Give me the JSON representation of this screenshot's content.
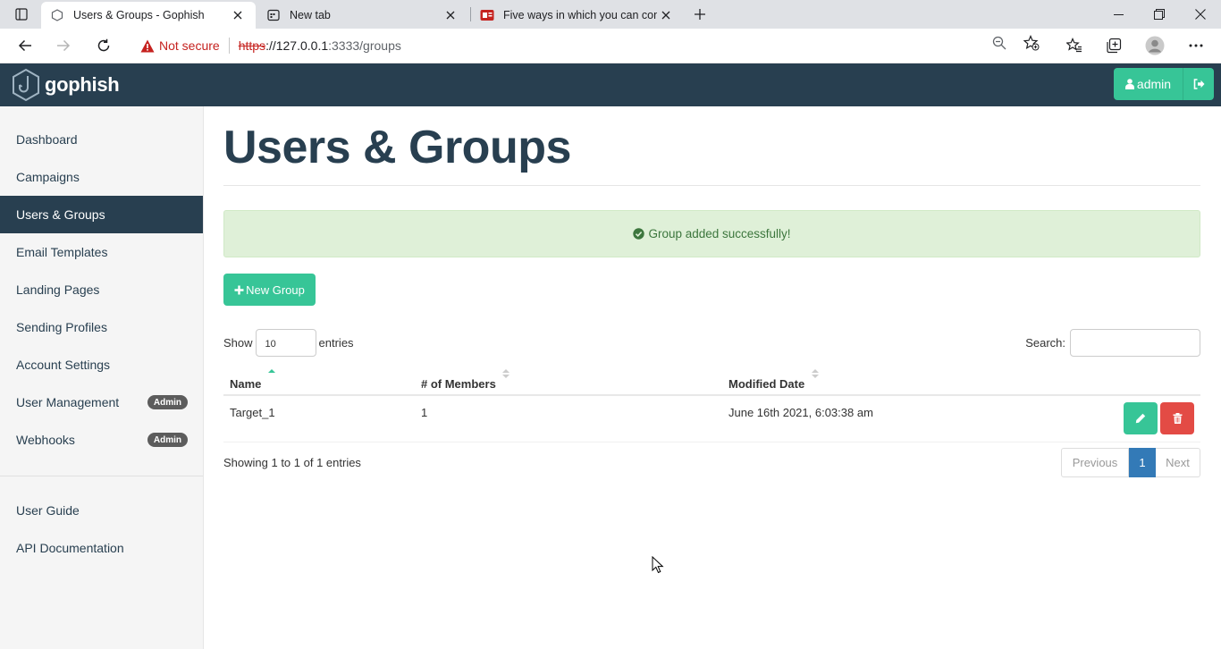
{
  "browser": {
    "tabs": [
      {
        "title": "Users & Groups - Gophish",
        "active": true
      },
      {
        "title": "New tab",
        "active": false
      },
      {
        "title": "Five ways in which you can comb",
        "active": false
      }
    ],
    "address": {
      "security_label": "Not secure",
      "scheme": "https",
      "host": "://127.0.0.1",
      "rest": ":3333/groups"
    }
  },
  "app": {
    "brand": "gophish",
    "user_label": "admin",
    "colors": {
      "navbar": "#283f50",
      "accent": "#37c597",
      "danger": "#e34b45",
      "page_active": "#337ab7"
    }
  },
  "sidebar": {
    "items": [
      {
        "label": "Dashboard"
      },
      {
        "label": "Campaigns"
      },
      {
        "label": "Users & Groups",
        "active": true
      },
      {
        "label": "Email Templates"
      },
      {
        "label": "Landing Pages"
      },
      {
        "label": "Sending Profiles"
      },
      {
        "label": "Account Settings"
      },
      {
        "label": "User Management",
        "badge": "Admin"
      },
      {
        "label": "Webhooks",
        "badge": "Admin"
      }
    ],
    "footer_items": [
      {
        "label": "User Guide"
      },
      {
        "label": "API Documentation"
      }
    ]
  },
  "main": {
    "title": "Users & Groups",
    "alert": "Group added successfully!",
    "new_group_label": "New Group",
    "show_label": "Show",
    "entries_label": "entries",
    "page_length": "10",
    "search_label": "Search:",
    "table": {
      "columns": [
        "Name",
        "# of Members",
        "Modified Date"
      ],
      "rows": [
        {
          "name": "Target_1",
          "members": "1",
          "modified": "June 16th 2021, 6:03:38 am"
        }
      ]
    },
    "info": "Showing 1 to 1 of 1 entries",
    "pagination": {
      "previous": "Previous",
      "current": "1",
      "next": "Next"
    }
  }
}
